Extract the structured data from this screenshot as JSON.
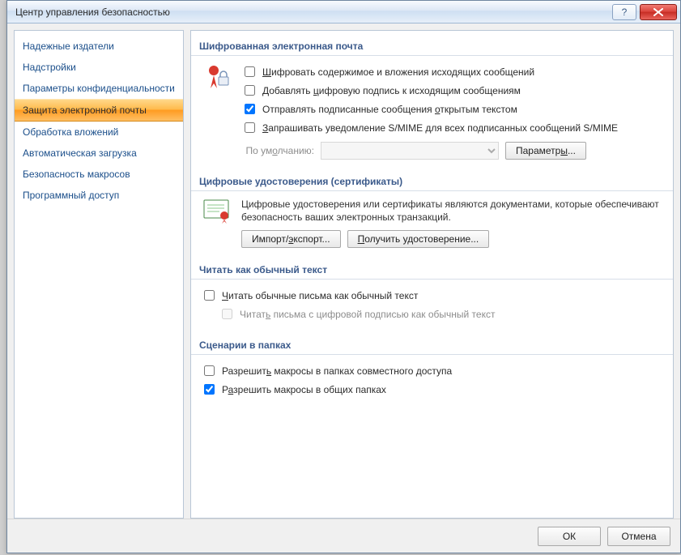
{
  "window": {
    "title": "Центр управления безопасностью"
  },
  "sidebar": {
    "items": [
      {
        "label": "Надежные издатели",
        "selected": false
      },
      {
        "label": "Надстройки",
        "selected": false
      },
      {
        "label": "Параметры конфиденциальности",
        "selected": false
      },
      {
        "label": "Защита электронной почты",
        "selected": true
      },
      {
        "label": "Обработка вложений",
        "selected": false
      },
      {
        "label": "Автоматическая загрузка",
        "selected": false
      },
      {
        "label": "Безопасность макросов",
        "selected": false
      },
      {
        "label": "Программный доступ",
        "selected": false
      }
    ]
  },
  "sections": {
    "encrypted": {
      "title": "Шифрованная электронная почта",
      "checks": [
        {
          "checked": false,
          "html": "<u>Ш</u>ифровать содержимое и вложения исходящих сообщений"
        },
        {
          "checked": false,
          "html": "Добавлять <u>ц</u>ифровую подпись к исходящим сообщениям"
        },
        {
          "checked": true,
          "html": "Отправлять подписанные сообщения <u>о</u>ткрытым текстом"
        },
        {
          "checked": false,
          "html": "<u>З</u>апрашивать уведомление S/MIME для всех подписанных сообщений S/MIME"
        }
      ],
      "default_label": "По ум<u>о</u>лчанию:",
      "params_button": "Параметр<u>ы</u>..."
    },
    "certs": {
      "title": "Цифровые удостоверения (сертификаты)",
      "desc": "Цифровые удостоверения или сертификаты являются документами, которые обеспечивают безопасность ваших электронных транзакций.",
      "import_button": "Импорт/<u>э</u>кспорт...",
      "get_button": "<u>П</u>олучить удостоверение..."
    },
    "plaintext": {
      "title": "Читать как обычный текст",
      "checks": [
        {
          "checked": false,
          "disabled": false,
          "html": "<u>Ч</u>итать обычные письма как обычный текст"
        },
        {
          "checked": false,
          "disabled": true,
          "html": "Читат<u>ь</u> письма с цифровой подписью как обычный текст"
        }
      ]
    },
    "scripts": {
      "title": "Сценарии в папках",
      "checks": [
        {
          "checked": false,
          "html": "Разрешит<u>ь</u> макросы в папках совместного доступа"
        },
        {
          "checked": true,
          "html": "Р<u>а</u>зрешить макросы в общих папках"
        }
      ]
    }
  },
  "footer": {
    "ok": "ОК",
    "cancel": "Отмена"
  }
}
